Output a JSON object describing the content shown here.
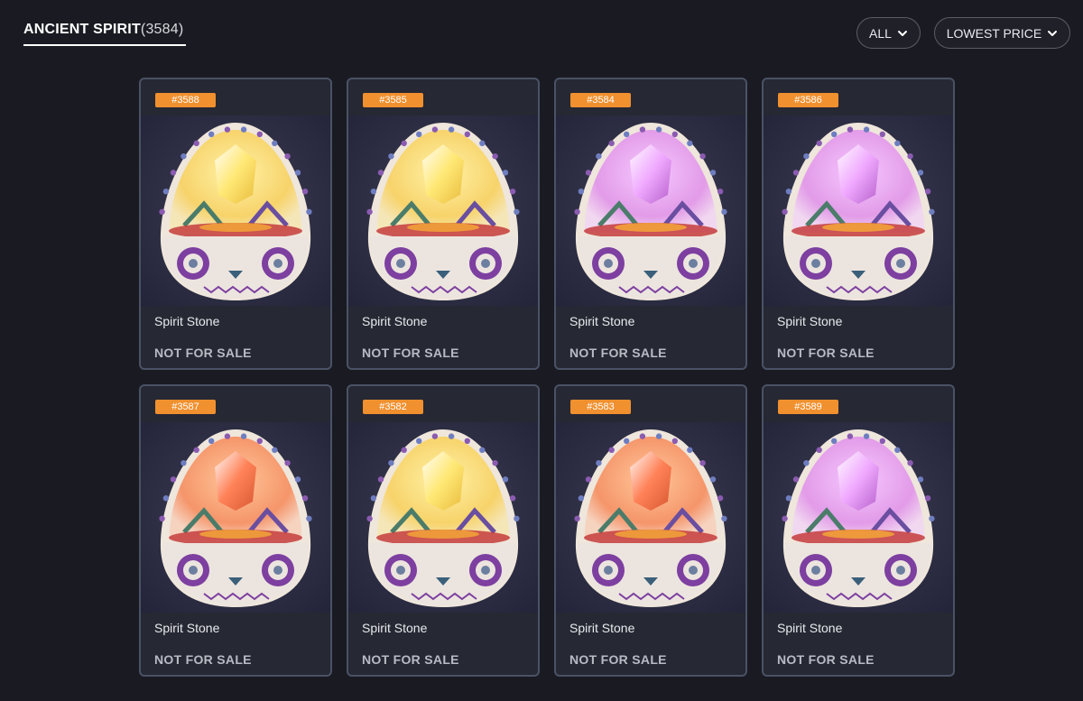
{
  "header": {
    "collection_name": "ANCIENT SPIRIT",
    "collection_count": "(3584)"
  },
  "filters": {
    "type_label": "ALL",
    "sort_label": "LOWEST PRICE"
  },
  "icons": {
    "dropdown": "chevron-down-icon"
  },
  "colors": {
    "background": "#1a1b22",
    "card_bg": "#262833",
    "card_border": "#4a5266",
    "badge": "#f0902e",
    "gem_yellow": "#ffe56a",
    "gem_purple": "#e88cf0",
    "gem_orange": "#ff8a55"
  },
  "cards": [
    {
      "id": "#3588",
      "name": "Spirit Stone",
      "status": "NOT FOR SALE",
      "variant": "yellow"
    },
    {
      "id": "#3585",
      "name": "Spirit Stone",
      "status": "NOT FOR SALE",
      "variant": "yellow"
    },
    {
      "id": "#3584",
      "name": "Spirit Stone",
      "status": "NOT FOR SALE",
      "variant": "purple"
    },
    {
      "id": "#3586",
      "name": "Spirit Stone",
      "status": "NOT FOR SALE",
      "variant": "purple"
    },
    {
      "id": "#3587",
      "name": "Spirit Stone",
      "status": "NOT FOR SALE",
      "variant": "orange"
    },
    {
      "id": "#3582",
      "name": "Spirit Stone",
      "status": "NOT FOR SALE",
      "variant": "yellow"
    },
    {
      "id": "#3583",
      "name": "Spirit Stone",
      "status": "NOT FOR SALE",
      "variant": "orange"
    },
    {
      "id": "#3589",
      "name": "Spirit Stone",
      "status": "NOT FOR SALE",
      "variant": "purple"
    }
  ]
}
